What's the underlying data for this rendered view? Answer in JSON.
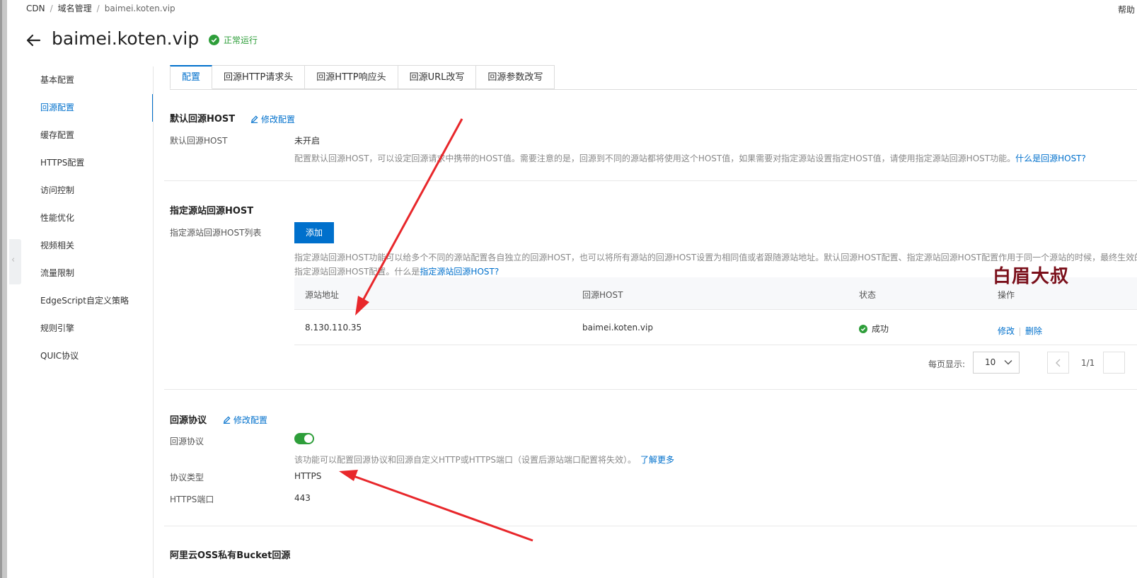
{
  "breadcrumb": [
    "CDN",
    "域名管理",
    "baimei.koten.vip"
  ],
  "help": "帮助",
  "title": "baimei.koten.vip",
  "status": "正常运行",
  "nav": [
    "基本配置",
    "回源配置",
    "缓存配置",
    "HTTPS配置",
    "访问控制",
    "性能优化",
    "视频相关",
    "流量限制",
    "EdgeScript自定义策略",
    "规则引擎",
    "QUIC协议"
  ],
  "nav_active": 1,
  "tabs": [
    "配置",
    "回源HTTP请求头",
    "回源HTTP响应头",
    "回源URL改写",
    "回源参数改写"
  ],
  "tab_active": 0,
  "default_host": {
    "title": "默认回源HOST",
    "edit": "修改配置",
    "label": "默认回源HOST",
    "value": "未开启",
    "desc": "配置默认回源HOST，可以设定回源请求中携带的HOST值。需要注意的是，回源到不同的源站都将使用这个HOST值，如果需要对指定源站设置指定HOST值，请使用指定源站回源HOST功能。",
    "link": "什么是回源HOST?"
  },
  "origin_host": {
    "title": "指定源站回源HOST",
    "label": "指定源站回源HOST列表",
    "add": "添加",
    "desc1": "指定源站回源HOST功能可以给多个不同的源站配置各自独立的回源HOST，也可以将所有源站的回源HOST设置为相同值或者跟随源站地址。默认回源HOST配置、指定源站回源HOST配置作用于同一个源站的时候，最终生效的",
    "desc2_prefix": "指定源站回源HOST配置。什么是",
    "desc2_link": "指定源站回源HOST?",
    "columns": [
      "源站地址",
      "回源HOST",
      "状态",
      "操作"
    ],
    "rows": [
      {
        "origin": "8.130.110.35",
        "host": "baimei.koten.vip",
        "status": "成功",
        "ops": [
          "修改",
          "删除"
        ]
      }
    ]
  },
  "pager": {
    "label": "每页显示:",
    "size": "10",
    "page": "1/1"
  },
  "protocol": {
    "title": "回源协议",
    "edit": "修改配置",
    "label": "回源协议",
    "enabled": true,
    "desc": "该功能可以配置回源协议和回源自定义HTTP或HTTPS端口（设置后源站端口配置将失效）。",
    "link": "了解更多",
    "type_label": "协议类型",
    "type_value": "HTTPS",
    "port_label": "HTTPS端口",
    "port_value": "443"
  },
  "oss": {
    "title": "阿里云OSS私有Bucket回源"
  },
  "watermark": "白眉大叔",
  "colors": {
    "accent": "#0070cc",
    "success": "#2e9e3a",
    "arrow": "#e8272b"
  }
}
